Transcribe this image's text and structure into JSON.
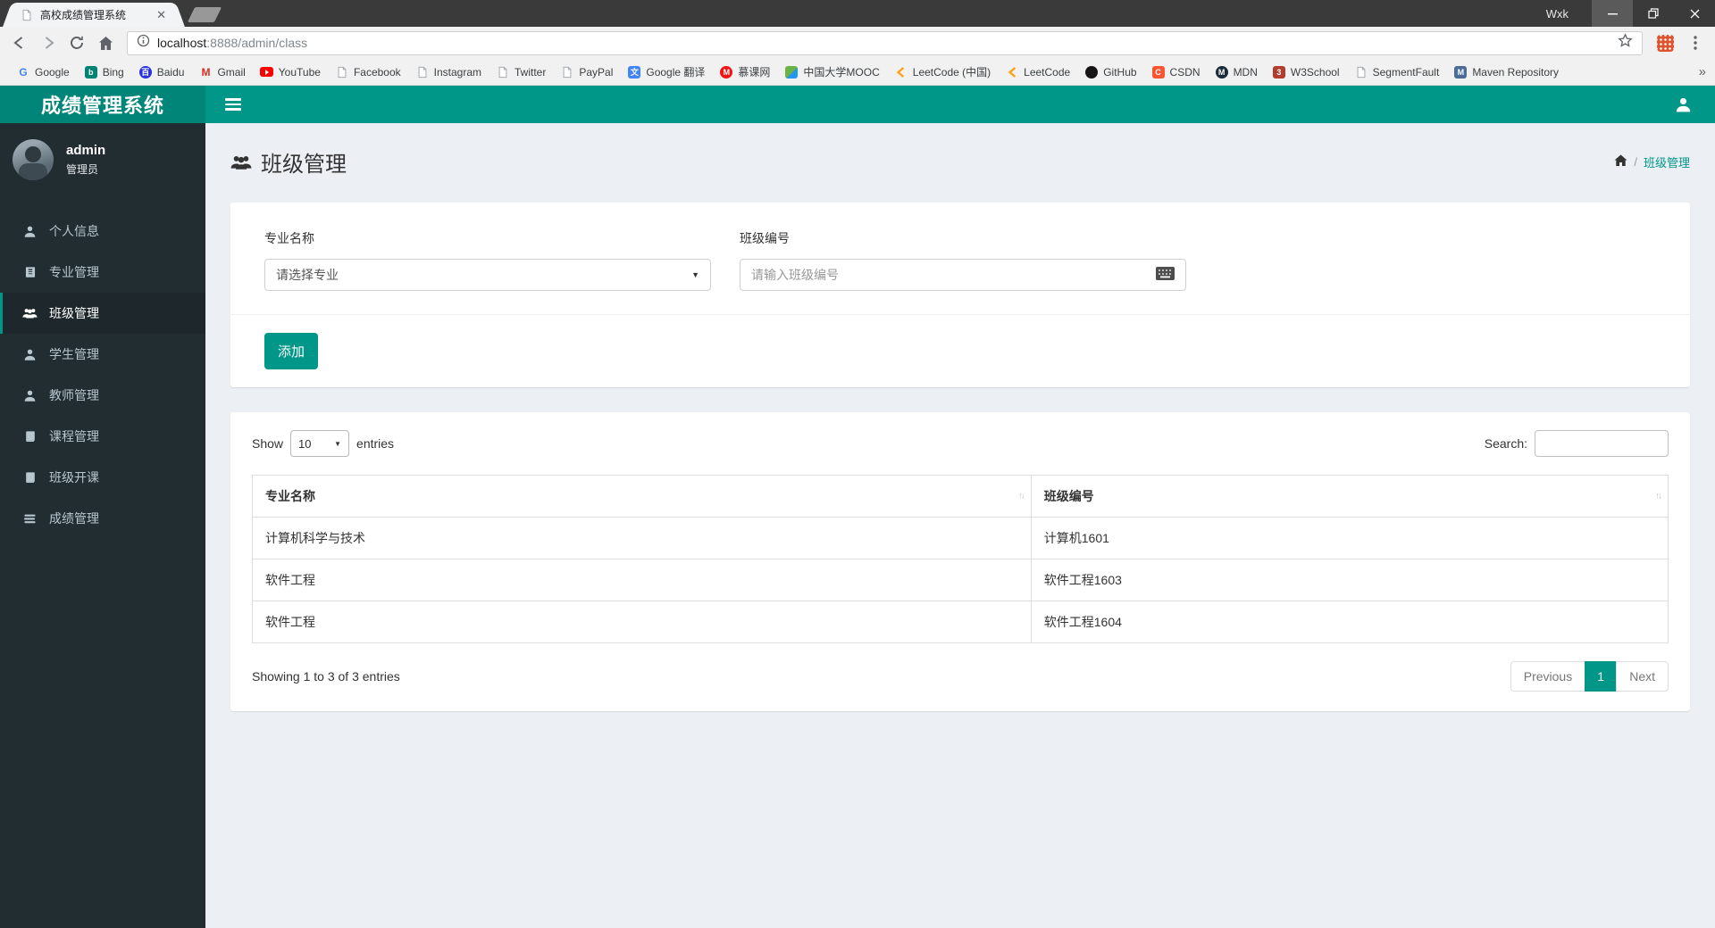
{
  "colors": {
    "accent": "#009688",
    "logo_bg": "#008578",
    "sidebar_bg": "#222d32",
    "sidebar_active_bg": "#1e282c",
    "content_bg": "#ecf0f5"
  },
  "browser": {
    "tab_title": "高校成绩管理系统",
    "profile_name": "Wxk",
    "url_host": "localhost",
    "url_rest": ":8888/admin/class",
    "overflow_chevron": "»",
    "bookmarks": [
      {
        "label": "Google",
        "icon": "google"
      },
      {
        "label": "Bing",
        "icon": "bing"
      },
      {
        "label": "Baidu",
        "icon": "baidu"
      },
      {
        "label": "Gmail",
        "icon": "gmail"
      },
      {
        "label": "YouTube",
        "icon": "youtube"
      },
      {
        "label": "Facebook",
        "icon": "page"
      },
      {
        "label": "Instagram",
        "icon": "page"
      },
      {
        "label": "Twitter",
        "icon": "page"
      },
      {
        "label": "PayPal",
        "icon": "page"
      },
      {
        "label": "Google 翻译",
        "icon": "gtranslate"
      },
      {
        "label": "慕课网",
        "icon": "imooc"
      },
      {
        "label": "中国大学MOOC",
        "icon": "icourse"
      },
      {
        "label": "LeetCode (中国)",
        "icon": "leetcode"
      },
      {
        "label": "LeetCode",
        "icon": "leetcode"
      },
      {
        "label": "GitHub",
        "icon": "github"
      },
      {
        "label": "CSDN",
        "icon": "csdn"
      },
      {
        "label": "MDN",
        "icon": "mdn"
      },
      {
        "label": "W3School",
        "icon": "w3school"
      },
      {
        "label": "SegmentFault",
        "icon": "page"
      },
      {
        "label": "Maven Repository",
        "icon": "maven"
      }
    ]
  },
  "navbar": {
    "brand": "成绩管理系统"
  },
  "sidebar": {
    "user_name": "admin",
    "user_role": "管理员",
    "items": [
      {
        "label": "个人信息",
        "icon": "user",
        "active": false
      },
      {
        "label": "专业管理",
        "icon": "notebook",
        "active": false
      },
      {
        "label": "班级管理",
        "icon": "users",
        "active": true
      },
      {
        "label": "学生管理",
        "icon": "user",
        "active": false
      },
      {
        "label": "教师管理",
        "icon": "user",
        "active": false
      },
      {
        "label": "课程管理",
        "icon": "book",
        "active": false
      },
      {
        "label": "班级开课",
        "icon": "book",
        "active": false
      },
      {
        "label": "成绩管理",
        "icon": "layers",
        "active": false
      }
    ]
  },
  "content": {
    "page_title": "班级管理",
    "breadcrumb": {
      "separator": "/",
      "current": "班级管理"
    },
    "form": {
      "major_label": "专业名称",
      "major_value": "请选择专业",
      "class_label": "班级编号",
      "class_placeholder": "请输入班级编号",
      "add_button": "添加"
    },
    "table": {
      "show_label": "Show",
      "page_size": "10",
      "entries_label": "entries",
      "search_label": "Search:",
      "columns": [
        "专业名称",
        "班级编号"
      ],
      "rows": [
        [
          "计算机科学与技术",
          "计算机1601"
        ],
        [
          "软件工程",
          "软件工程1603"
        ],
        [
          "软件工程",
          "软件工程1604"
        ]
      ],
      "info": "Showing 1 to 3 of 3 entries",
      "prev_label": "Previous",
      "current_page": "1",
      "next_label": "Next"
    }
  }
}
